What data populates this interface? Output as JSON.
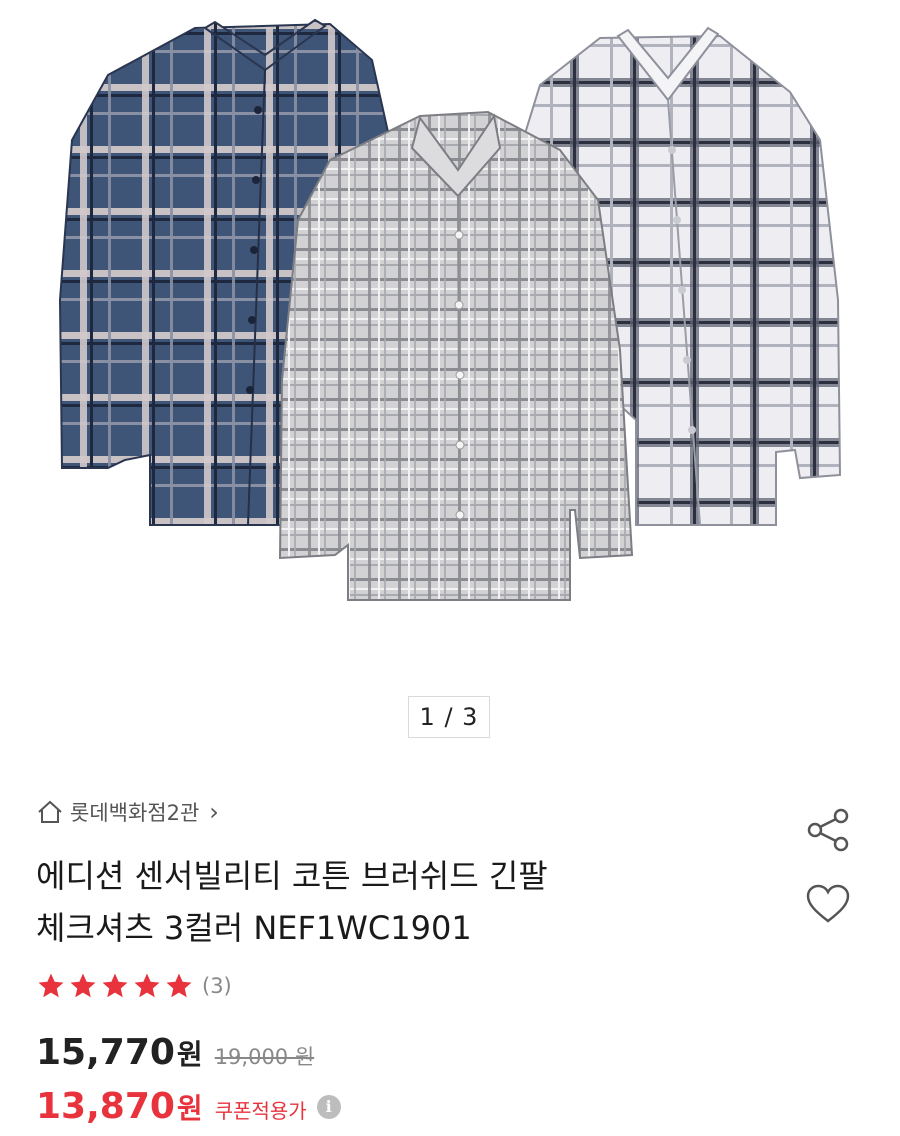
{
  "gallery": {
    "images": [
      "navy-check-shirt",
      "gray-check-shirt",
      "white-check-shirt"
    ],
    "current_page": 1,
    "total_pages": 3,
    "indicator_text": "1 / 3"
  },
  "store": {
    "icon": "home-icon",
    "name": "롯데백화점2관",
    "chevron": "›"
  },
  "actions": {
    "share_icon": "share-icon",
    "wish_icon": "heart-icon"
  },
  "product": {
    "title_line1": "에디션 센서빌리티 코튼 브러쉬드 긴팔",
    "title_line2": "체크셔츠 3컬러 NEF1WC1901"
  },
  "rating": {
    "stars": 5,
    "max_stars": 5,
    "review_count_text": "(3)",
    "star_color": "#e8333d"
  },
  "price": {
    "sale_value": "15,770",
    "unit": "원",
    "original": "19,000 원",
    "coupon_value": "13,870",
    "coupon_label": "쿠폰적용가",
    "accent_color": "#e8333d"
  }
}
